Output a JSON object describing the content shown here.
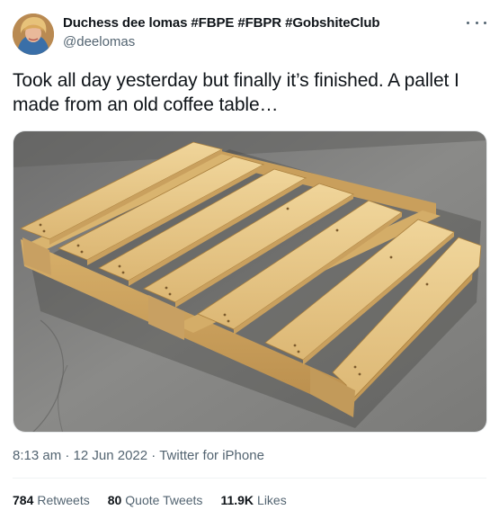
{
  "author": {
    "display_name": "Duchess dee lomas #FBPE #FBPR #GobshiteClub",
    "handle": "@deelomas",
    "avatar_icon": "profile-avatar"
  },
  "more_icon": "more-horizontal-icon",
  "tweet": {
    "text": "Took all day yesterday but finally it’s finished. A pallet I\nmade from an old coffee table…",
    "media_description_icon": "photo-wooden-pallet"
  },
  "meta": {
    "time": "8:13 am",
    "separator": " · ",
    "date": "12 Jun 2022",
    "source": "Twitter for iPhone"
  },
  "stats": {
    "retweets_count": "784",
    "retweets_label": "Retweets",
    "quotes_count": "80",
    "quotes_label": "Quote Tweets",
    "likes_count": "11.9K",
    "likes_label": "Likes"
  },
  "colors": {
    "text_primary": "#0f1419",
    "text_secondary": "#536471",
    "divider": "#eff3f4",
    "background": "#ffffff"
  }
}
